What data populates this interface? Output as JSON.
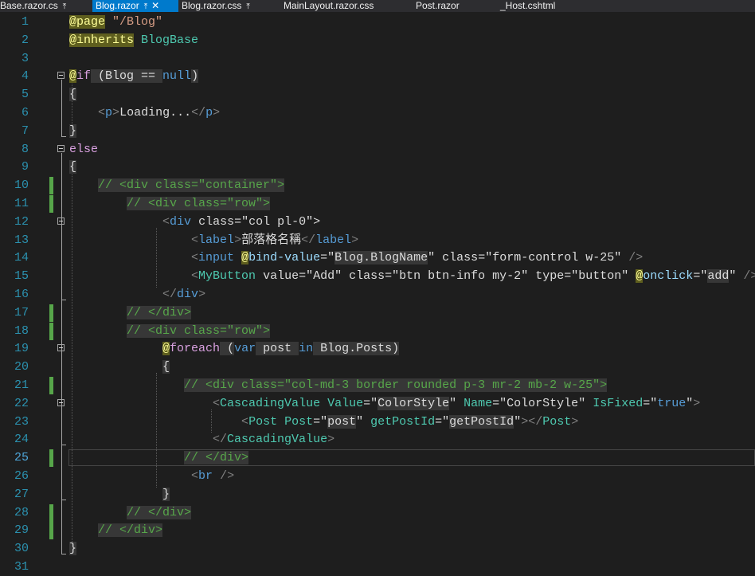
{
  "tabs": [
    {
      "label": "Base.razor.cs",
      "pinned": true,
      "active": false,
      "closable": false
    },
    {
      "label": "Blog.razor",
      "pinned": true,
      "active": true,
      "closable": true
    },
    {
      "label": "Blog.razor.css",
      "pinned": true,
      "active": false,
      "closable": false
    },
    {
      "label": "MainLayout.razor.css",
      "pinned": false,
      "active": false,
      "closable": false
    },
    {
      "label": "Post.razor",
      "pinned": false,
      "active": false,
      "closable": false
    },
    {
      "label": "_Host.cshtml",
      "pinned": false,
      "active": false,
      "closable": false
    }
  ],
  "icons": {
    "pin": "pin-icon",
    "close": "close-icon",
    "fold": "collapse-minus-icon"
  },
  "colors": {
    "background": "#1e1e1e",
    "tab_active": "#007acc",
    "line_number": "#2b91af",
    "change_bar": "#57a64a",
    "comment": "#57a64a",
    "string": "#d69d85",
    "html_tag": "#569cd6",
    "component": "#4ec9b0",
    "razor_highlight": "#5e5e1e"
  },
  "current_line": 25,
  "lines": [
    {
      "n": "1",
      "tokens": [
        [
          "@page",
          "razor"
        ],
        [
          " ",
          "w"
        ],
        [
          "\"/Blog\"",
          "str"
        ]
      ]
    },
    {
      "n": "2",
      "tokens": [
        [
          "@inherits",
          "razor"
        ],
        [
          " ",
          "w"
        ],
        [
          "BlogBase",
          "dir"
        ]
      ]
    },
    {
      "n": "3",
      "tokens": []
    },
    {
      "n": "4",
      "tokens": [
        [
          "@",
          "razor"
        ],
        [
          "if",
          "kw2"
        ],
        [
          " (Blog == ",
          "code"
        ],
        [
          "null",
          "kw"
        ],
        [
          ")",
          "code"
        ]
      ]
    },
    {
      "n": "5",
      "tokens": [
        [
          "{",
          "code"
        ]
      ]
    },
    {
      "n": "6",
      "tokens": [
        [
          "    ",
          "w"
        ],
        [
          "<",
          "punc"
        ],
        [
          "p",
          "tag"
        ],
        [
          ">",
          "punc"
        ],
        [
          "Loading...",
          "w"
        ],
        [
          "</",
          "punc"
        ],
        [
          "p",
          "tag"
        ],
        [
          ">",
          "punc"
        ]
      ]
    },
    {
      "n": "7",
      "tokens": [
        [
          "}",
          "code"
        ]
      ]
    },
    {
      "n": "8",
      "tokens": [
        [
          "else",
          "kw2"
        ]
      ]
    },
    {
      "n": "9",
      "tokens": [
        [
          "{",
          "code"
        ]
      ]
    },
    {
      "n": "10",
      "tokens": [
        [
          "    ",
          "w"
        ],
        [
          "// <div class=\"container\">",
          "cmt"
        ]
      ]
    },
    {
      "n": "11",
      "tokens": [
        [
          "        ",
          "w"
        ],
        [
          "// <div class=\"row\">",
          "cmt"
        ]
      ]
    },
    {
      "n": "12",
      "tokens": [
        [
          "             ",
          "w"
        ],
        [
          "<",
          "punc"
        ],
        [
          "div",
          "tag"
        ],
        [
          " class",
          "w"
        ],
        [
          "=\"",
          "w"
        ],
        [
          "col pl-0",
          "w"
        ],
        [
          "\">",
          "w"
        ]
      ]
    },
    {
      "n": "13",
      "tokens": [
        [
          "                 ",
          "w"
        ],
        [
          "<",
          "punc"
        ],
        [
          "label",
          "tag"
        ],
        [
          ">",
          "punc"
        ],
        [
          "部落格名稱",
          "w"
        ],
        [
          "</",
          "punc"
        ],
        [
          "label",
          "tag"
        ],
        [
          ">",
          "punc"
        ]
      ]
    },
    {
      "n": "14",
      "tokens": [
        [
          "                 ",
          "w"
        ],
        [
          "<",
          "punc"
        ],
        [
          "input",
          "tag"
        ],
        [
          " ",
          "w"
        ],
        [
          "@",
          "razor"
        ],
        [
          "bind-value",
          "attr"
        ],
        [
          "=\"",
          "w"
        ],
        [
          "Blog.BlogName",
          "code"
        ],
        [
          "\"",
          "w"
        ],
        [
          " class",
          "w"
        ],
        [
          "=\"",
          "w"
        ],
        [
          "form-control w-25",
          "w"
        ],
        [
          "\"",
          "w"
        ],
        [
          " />",
          "punc"
        ]
      ]
    },
    {
      "n": "15",
      "tokens": [
        [
          "                 ",
          "w"
        ],
        [
          "<",
          "punc"
        ],
        [
          "MyButton",
          "comp"
        ],
        [
          " value",
          "w"
        ],
        [
          "=\"",
          "w"
        ],
        [
          "Add",
          "w"
        ],
        [
          "\"",
          "w"
        ],
        [
          " class",
          "w"
        ],
        [
          "=\"",
          "w"
        ],
        [
          "btn btn-info my-2",
          "w"
        ],
        [
          "\"",
          "w"
        ],
        [
          " type",
          "w"
        ],
        [
          "=\"",
          "w"
        ],
        [
          "button",
          "w"
        ],
        [
          "\"",
          "w"
        ],
        [
          " ",
          "w"
        ],
        [
          "@",
          "razor"
        ],
        [
          "onclick",
          "attr"
        ],
        [
          "=\"",
          "w"
        ],
        [
          "add",
          "code"
        ],
        [
          "\"",
          "w"
        ],
        [
          " />",
          "punc"
        ]
      ]
    },
    {
      "n": "16",
      "tokens": [
        [
          "             ",
          "w"
        ],
        [
          "</",
          "punc"
        ],
        [
          "div",
          "tag"
        ],
        [
          ">",
          "punc"
        ]
      ]
    },
    {
      "n": "17",
      "tokens": [
        [
          "        ",
          "w"
        ],
        [
          "// </div>",
          "cmt"
        ]
      ]
    },
    {
      "n": "18",
      "tokens": [
        [
          "        ",
          "w"
        ],
        [
          "// <div class=\"row\">",
          "cmt"
        ]
      ]
    },
    {
      "n": "19",
      "tokens": [
        [
          "             ",
          "w"
        ],
        [
          "@",
          "razor"
        ],
        [
          "foreach",
          "kw2"
        ],
        [
          " (",
          "code"
        ],
        [
          "var",
          "kw"
        ],
        [
          " post ",
          "code"
        ],
        [
          "in",
          "kw"
        ],
        [
          " Blog.Posts)",
          "code"
        ]
      ]
    },
    {
      "n": "20",
      "tokens": [
        [
          "             ",
          "w"
        ],
        [
          "{",
          "code"
        ]
      ]
    },
    {
      "n": "21",
      "tokens": [
        [
          "                ",
          "w"
        ],
        [
          "// <div class=\"col-md-3 border rounded p-3 mr-2 mb-2 w-25\">",
          "cmt"
        ]
      ]
    },
    {
      "n": "22",
      "tokens": [
        [
          "                    ",
          "w"
        ],
        [
          "<",
          "punc"
        ],
        [
          "CascadingValue",
          "comp"
        ],
        [
          " Value",
          "comp"
        ],
        [
          "=\"",
          "w"
        ],
        [
          "ColorStyle",
          "code"
        ],
        [
          "\"",
          "w"
        ],
        [
          " Name",
          "comp"
        ],
        [
          "=\"",
          "w"
        ],
        [
          "ColorStyle",
          "w"
        ],
        [
          "\"",
          "w"
        ],
        [
          " IsFixed",
          "comp"
        ],
        [
          "=\"",
          "w"
        ],
        [
          "true",
          "kw"
        ],
        [
          "\"",
          "w"
        ],
        [
          ">",
          "punc"
        ]
      ]
    },
    {
      "n": "23",
      "tokens": [
        [
          "                        ",
          "w"
        ],
        [
          "<",
          "punc"
        ],
        [
          "Post",
          "comp"
        ],
        [
          " Post",
          "comp"
        ],
        [
          "=\"",
          "w"
        ],
        [
          "post",
          "code"
        ],
        [
          "\"",
          "w"
        ],
        [
          " getPostId",
          "comp"
        ],
        [
          "=\"",
          "w"
        ],
        [
          "getPostId",
          "code"
        ],
        [
          "\"",
          "w"
        ],
        [
          "></",
          "punc"
        ],
        [
          "Post",
          "comp"
        ],
        [
          ">",
          "punc"
        ]
      ]
    },
    {
      "n": "24",
      "tokens": [
        [
          "                    ",
          "w"
        ],
        [
          "</",
          "punc"
        ],
        [
          "CascadingValue",
          "comp"
        ],
        [
          ">",
          "punc"
        ]
      ]
    },
    {
      "n": "25",
      "tokens": [
        [
          "                ",
          "w"
        ],
        [
          "// </div>",
          "cmt"
        ]
      ]
    },
    {
      "n": "26",
      "tokens": [
        [
          "                 ",
          "w"
        ],
        [
          "<",
          "punc"
        ],
        [
          "br",
          "tag"
        ],
        [
          " />",
          "punc"
        ]
      ]
    },
    {
      "n": "27",
      "tokens": [
        [
          "             ",
          "w"
        ],
        [
          "}",
          "code"
        ]
      ]
    },
    {
      "n": "28",
      "tokens": [
        [
          "        ",
          "w"
        ],
        [
          "// </div>",
          "cmt"
        ]
      ]
    },
    {
      "n": "29",
      "tokens": [
        [
          "    ",
          "w"
        ],
        [
          "// </div>",
          "cmt"
        ]
      ]
    },
    {
      "n": "30",
      "tokens": [
        [
          "}",
          "code"
        ]
      ]
    },
    {
      "n": "31",
      "tokens": []
    }
  ]
}
